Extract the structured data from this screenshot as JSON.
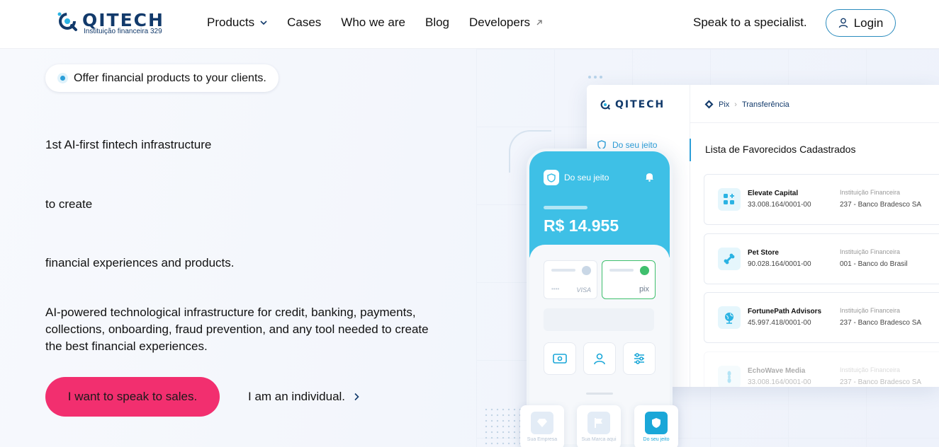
{
  "header": {
    "logo_word": "QITECH",
    "logo_sub": "Instituição financeira 329",
    "nav": [
      {
        "label": "Products"
      },
      {
        "label": "Cases"
      },
      {
        "label": "Who we are"
      },
      {
        "label": "Blog"
      },
      {
        "label": "Developers"
      }
    ],
    "speak_link": "Speak to a specialist.",
    "login_label": "Login"
  },
  "hero": {
    "pill": "Offer financial products to your clients.",
    "line1": "1st AI-first fintech infrastructure",
    "line2": "to create",
    "line3": "financial experiences and products.",
    "description": "AI-powered technological infrastructure for credit, banking, payments, collections, onboarding, fraud prevention, and any tool needed to create the best financial experiences.",
    "cta_primary": "I want to speak to sales.",
    "cta_secondary": "I am an individual."
  },
  "dashboard": {
    "logo_word": "QITECH",
    "breadcrumb": [
      "Pix",
      "Transferência"
    ],
    "sidebar_item": "Do seu jeito",
    "list_title": "Lista de Favorecidos Cadastrados",
    "institution_label": "Instituição Financeira",
    "favorites": [
      {
        "name": "Elevate Capital",
        "doc": "33.008.164/0001-00",
        "bank": "237 - Banco Bradesco SA"
      },
      {
        "name": "Pet Store",
        "doc": "90.028.164/0001-00",
        "bank": "001 - Banco do Brasil"
      },
      {
        "name": "FortunePath Advisors",
        "doc": "45.997.418/0001-00",
        "bank": "237 - Banco Bradesco SA"
      },
      {
        "name": "EchoWave Media",
        "doc": "33.008.164/0001-00",
        "bank": "237 - Banco Bradesco SA"
      }
    ]
  },
  "phone": {
    "title": "Do seu jeito",
    "balance": "R$ 14.955",
    "card1_brand": "VISA",
    "card1_mask": "••••",
    "card2_brand": "pix",
    "tabs": [
      {
        "label": "Sua Empresa"
      },
      {
        "label": "Sua Marca aqui"
      },
      {
        "label": "Do seu jeito"
      }
    ]
  },
  "colors": {
    "accent": "#2b9ed8",
    "cta": "#f22f6f",
    "brand_navy": "#123a6b",
    "phone_header": "#3ec0e6"
  }
}
